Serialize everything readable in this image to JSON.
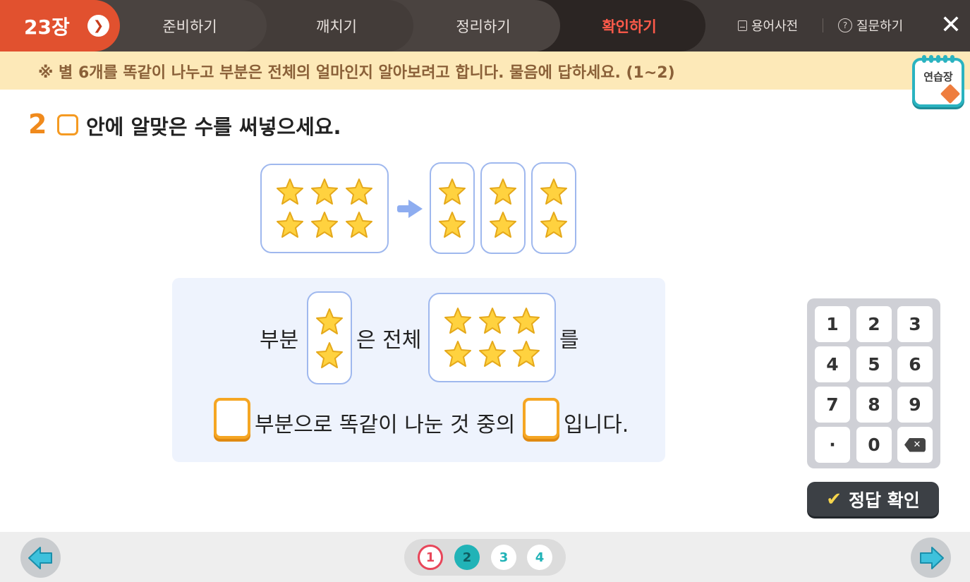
{
  "header": {
    "chapter": "23장",
    "tabs": [
      {
        "label": "준비하기"
      },
      {
        "label": "깨치기"
      },
      {
        "label": "정리하기"
      },
      {
        "label": "확인하기",
        "active": true
      }
    ],
    "dictionary": "용어사전",
    "ask": "질문하기",
    "accent_color": "#e1512f",
    "active_tab_color": "#ff5a4a"
  },
  "instruction": "※ 별 6개를 똑같이 나누고 부분은 전체의 얼마인지 알아보려고 합니다. 물음에 답하세요. (1~2)",
  "practice_label": "연습장",
  "question": {
    "number": "2",
    "text": "안에 알맞은 수를 써넣으세요."
  },
  "illustration": {
    "whole_stars": 6,
    "groups": [
      2,
      2,
      2
    ]
  },
  "sentence": {
    "part": "부분",
    "is_whole": "은 전체",
    "particle": "를",
    "middle": "부분으로 똑같이 나눈 것 중의",
    "ending": "입니다.",
    "answer1": "",
    "answer2": ""
  },
  "keypad": {
    "keys": [
      "1",
      "2",
      "3",
      "4",
      "5",
      "6",
      "7",
      "8",
      "9",
      "·",
      "0",
      "backspace-icon"
    ],
    "submit": "정답 확인"
  },
  "pagination": {
    "pages": [
      "1",
      "2",
      "3",
      "4"
    ],
    "current": "2"
  }
}
